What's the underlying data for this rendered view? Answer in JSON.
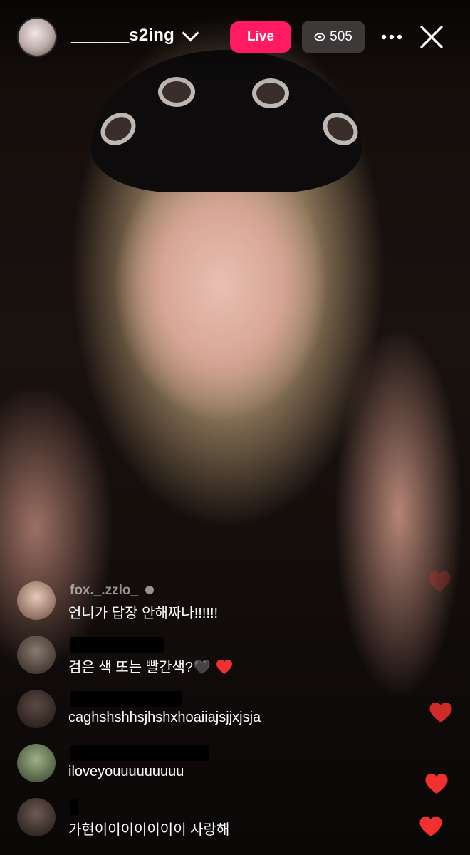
{
  "header": {
    "username": "______s2ing",
    "live_label": "Live",
    "viewer_count": "505"
  },
  "icons": {
    "avatar": "avatar",
    "chevron": "chevron-down-icon",
    "eye": "eye-icon",
    "more": "more-options-icon",
    "close": "close-icon",
    "heart": "heart-icon",
    "verified": "verified-badge-icon"
  },
  "comments": [
    {
      "username": "fox._.zzlo_",
      "text": "언니가 답장 안해짜나!!!!!!"
    },
    {
      "username": "",
      "text": "검은 색 또는 빨간색?🖤"
    },
    {
      "username": "",
      "text": "caghshshhsjhshxhoaiiajsjjxjsja"
    },
    {
      "username": "",
      "text": "iloveyouuuuuuuuu"
    },
    {
      "username": "",
      "text": "가현이이이이이이이 사랑해"
    }
  ],
  "colors": {
    "live_badge": "#ff1a62",
    "heart": "#f0312f",
    "viewer_badge_bg": "#464242"
  }
}
